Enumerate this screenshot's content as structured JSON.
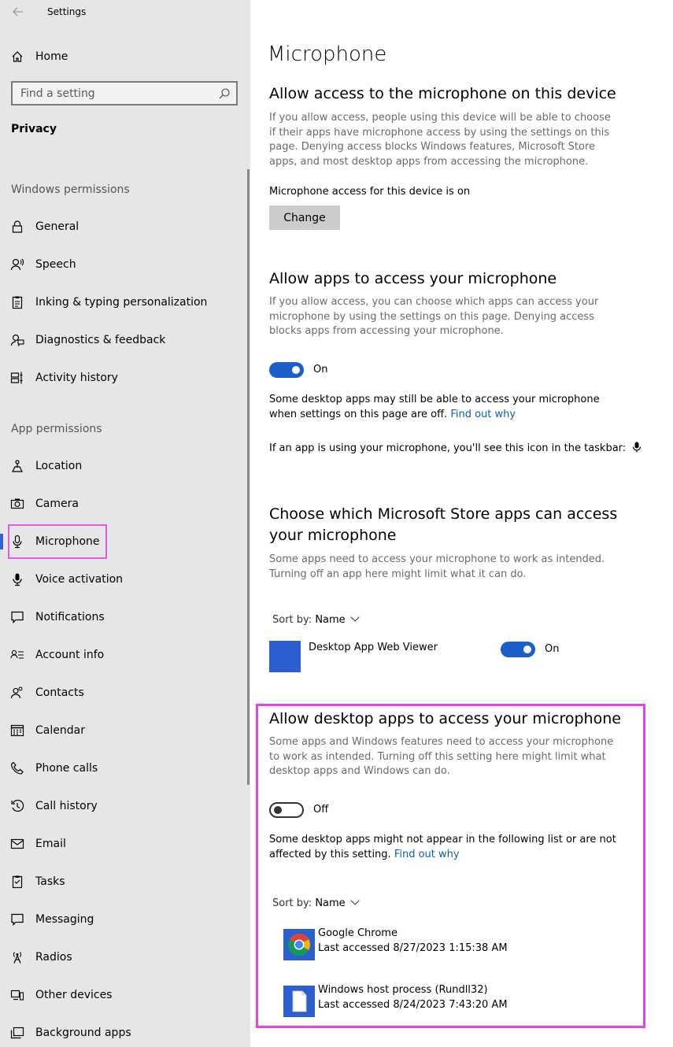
{
  "window": {
    "title": "Settings"
  },
  "sidebar": {
    "home_label": "Home",
    "search_placeholder": "Find a setting",
    "section": "Privacy",
    "windows_permissions": "Windows permissions",
    "windows_items": [
      {
        "label": "General",
        "icon": "lock-icon"
      },
      {
        "label": "Speech",
        "icon": "speech-icon"
      },
      {
        "label": "Inking & typing personalization",
        "icon": "clipboard-icon"
      },
      {
        "label": "Diagnostics & feedback",
        "icon": "feedback-icon"
      },
      {
        "label": "Activity history",
        "icon": "timeline-icon"
      }
    ],
    "app_permissions": "App permissions",
    "app_items": [
      {
        "label": "Location",
        "icon": "location-icon"
      },
      {
        "label": "Camera",
        "icon": "camera-icon"
      },
      {
        "label": "Microphone",
        "icon": "microphone-icon"
      },
      {
        "label": "Voice activation",
        "icon": "microphone-filled-icon"
      },
      {
        "label": "Notifications",
        "icon": "notification-icon"
      },
      {
        "label": "Account info",
        "icon": "account-info-icon"
      },
      {
        "label": "Contacts",
        "icon": "contacts-icon"
      },
      {
        "label": "Calendar",
        "icon": "calendar-icon"
      },
      {
        "label": "Phone calls",
        "icon": "phone-icon"
      },
      {
        "label": "Call history",
        "icon": "history-icon"
      },
      {
        "label": "Email",
        "icon": "mail-icon"
      },
      {
        "label": "Tasks",
        "icon": "tasks-icon"
      },
      {
        "label": "Messaging",
        "icon": "message-icon"
      },
      {
        "label": "Radios",
        "icon": "radio-icon"
      },
      {
        "label": "Other devices",
        "icon": "devices-icon"
      },
      {
        "label": "Background apps",
        "icon": "background-apps-icon"
      }
    ],
    "selected": "Microphone"
  },
  "main": {
    "title": "Microphone",
    "device": {
      "heading": "Allow access to the microphone on this device",
      "description": "If you allow access, people using this device will be able to choose if their apps have microphone access by using the settings on this page. Denying access blocks Windows features, Microsoft Store apps, and most desktop apps from accessing the microphone.",
      "status": "Microphone access for this device is on",
      "change_label": "Change"
    },
    "apps": {
      "heading": "Allow apps to access your microphone",
      "description": "If you allow access, you can choose which apps can access your microphone by using the settings on this page. Denying access blocks apps from accessing your microphone.",
      "toggle_state": "On",
      "note_text": "Some desktop apps may still be able to access your microphone when settings on this page are off.",
      "note_link": "Find out why",
      "taskbar_note": "If an app is using your microphone, you'll see this icon in the taskbar:"
    },
    "store": {
      "heading_line1": "Choose which Microsoft Store apps can access",
      "heading_line2": "your microphone",
      "description": "Some apps need to access your microphone to work as intended. Turning off an app here might limit what it can do.",
      "sort_prefix": "Sort by:",
      "sort_value": "Name",
      "app_name": "Desktop App Web Viewer",
      "app_toggle_state": "On"
    },
    "desktop": {
      "heading": "Allow desktop apps to access your microphone",
      "description": "Some apps and Windows features need to access your microphone to work as intended. Turning off this setting here might limit what desktop apps and Windows can do.",
      "toggle_state": "Off",
      "note_text": "Some desktop apps might not appear in the following list or are not affected by this setting.",
      "note_link": "Find out why",
      "sort_prefix": "Sort by:",
      "sort_value": "Name",
      "apps": [
        {
          "name": "Google Chrome",
          "last": "Last accessed 8/27/2023 1:15:38 AM",
          "icon": "chrome-icon"
        },
        {
          "name": "Windows host process (Rundll32)",
          "last": "Last accessed 8/24/2023 7:43:20 AM",
          "icon": "document-icon"
        }
      ]
    }
  },
  "colors": {
    "accent": "#1a5fcc",
    "link": "#0a5fb4",
    "highlight": "#e542e5"
  }
}
